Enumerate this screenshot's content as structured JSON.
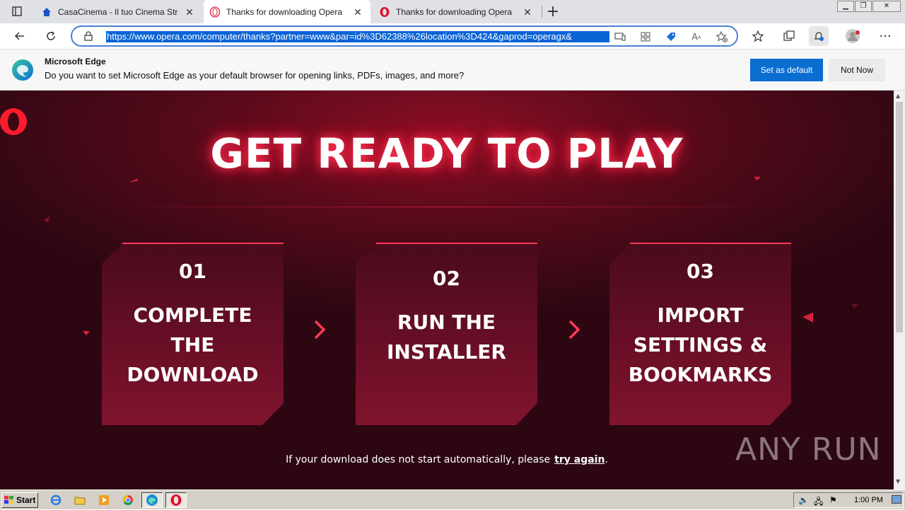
{
  "tabs": [
    {
      "label": "CasaCinema - Il tuo Cinema Streaming",
      "icon": "home-icon",
      "active": false
    },
    {
      "label": "Thanks for downloading Opera",
      "icon": "opera-icon",
      "active": true
    },
    {
      "label": "Thanks for downloading Opera",
      "icon": "opera-icon",
      "active": false
    }
  ],
  "address_bar": {
    "url": "https://www.opera.com/computer/thanks?partner=www&par=id%3D62388%26location%3D424&gaprod=operagx&"
  },
  "infobar": {
    "title": "Microsoft Edge",
    "message": "Do you want to set Microsoft Edge as your default browser for opening links, PDFs, images, and more?",
    "set_default_label": "Set as default",
    "not_now_label": "Not Now"
  },
  "page": {
    "hero_title": "GET READY TO PLAY",
    "steps": [
      {
        "number": "01",
        "lines": [
          "COMPLETE",
          "THE",
          "DOWNLOAD"
        ]
      },
      {
        "number": "02",
        "lines": [
          "RUN THE",
          "INSTALLER"
        ]
      },
      {
        "number": "03",
        "lines": [
          "IMPORT",
          "SETTINGS &",
          "BOOKMARKS"
        ]
      }
    ],
    "footer_text": "If your download does not start automatically, please",
    "footer_link": "try again",
    "footer_end": ".",
    "watermark": "ANY RUN"
  },
  "taskbar": {
    "start_label": "Start",
    "clock": "1:00 PM"
  },
  "colors": {
    "accent": "#ff3a55",
    "edge_blue": "#0a6ed1",
    "page_bg": "#5a0a1b"
  }
}
